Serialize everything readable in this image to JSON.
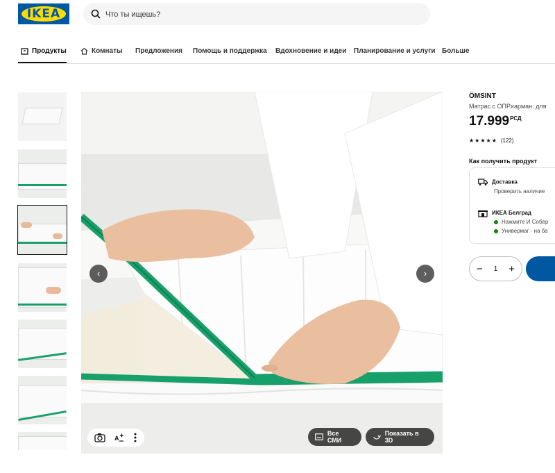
{
  "header": {
    "logo_text": "IKEA",
    "search_placeholder": "Что ты ищешь?"
  },
  "nav": {
    "items": [
      {
        "label": "Продукты",
        "icon": "box-icon",
        "active": true
      },
      {
        "label": "Комнаты",
        "icon": "home-icon",
        "active": false
      },
      {
        "label": "Предложения",
        "active": false
      },
      {
        "label": "Помощь и поддержка",
        "active": false
      },
      {
        "label": "Вдохновение и идеи",
        "active": false
      },
      {
        "label": "Планирование и услуги",
        "active": false
      },
      {
        "label": "Больше",
        "active": false
      }
    ]
  },
  "gallery": {
    "thumbnail_count": 7,
    "selected_index": 2,
    "main_image_alt": "Hands unzipping white mattress cover with green zipper",
    "prev_icon": "chevron-left-icon",
    "next_icon": "chevron-right-icon",
    "tools": [
      "camera-icon",
      "ar-icon",
      "more-icon"
    ],
    "all_media_label": "Все СМИ",
    "show_3d_label": "Показать в 3D"
  },
  "product": {
    "name": "ÖMSINT",
    "description": "Матрас с ОПР.карман. для",
    "price": "17.999",
    "currency": "РСД",
    "rating_stars": "★★★★★",
    "rating_value": 4.5,
    "review_count": "(122)",
    "how_to_get": "Как получить продукт",
    "delivery_title": "Доставка",
    "delivery_sub": "Проверить наличие",
    "store_title": "ИКЕА Белград",
    "store_line1": "Нажмите И Собер",
    "store_line2": "Универмаг - на ба",
    "quantity": "1"
  },
  "colors": {
    "brand_blue": "#0058a3",
    "brand_yellow": "#ffdb00",
    "zipper_green": "#18a06a",
    "stock_green": "#0a8a00"
  }
}
